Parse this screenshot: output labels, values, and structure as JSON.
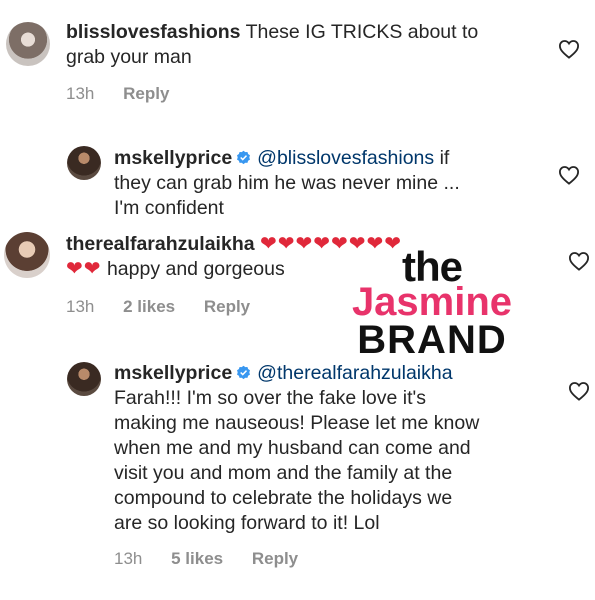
{
  "colors": {
    "accent_red": "#e0283a",
    "mention": "#00376b",
    "meta_gray": "#8e8e8e",
    "watermark_pink": "#e8336b"
  },
  "comments": [
    {
      "username": "blisslovesfashions",
      "verified": false,
      "text_lines": [
        "These IG TRICKS about to",
        "grab your man"
      ],
      "time": "13h",
      "reply_label": "Reply"
    },
    {
      "username": "mskellyprice",
      "verified": true,
      "mention": "@blisslovesfashions",
      "text_lines": [
        "if",
        "they can grab him he was never mine ...",
        "I'm confident"
      ]
    },
    {
      "username": "therealfarahzulaikha",
      "verified": false,
      "hearts_line1": "❤❤❤❤❤❤❤❤",
      "hearts_line2": "❤❤",
      "text": "happy and gorgeous",
      "time": "13h",
      "likes": "2 likes",
      "reply_label": "Reply"
    },
    {
      "username": "mskellyprice",
      "verified": true,
      "mention": "@therealfarahzulaikha",
      "text_lines": [
        "Farah!!! I'm so over the fake love it's",
        "making me nauseous! Please let me know",
        "when me and my husband can come and",
        "visit you and mom and the family at the",
        "compound to celebrate the holidays we",
        "are so looking forward to it! Lol"
      ],
      "time": "13h",
      "likes": "5 likes",
      "reply_label": "Reply"
    }
  ],
  "watermark": {
    "line1": "the",
    "line2": "Jasmine",
    "line3": "BRAND"
  }
}
